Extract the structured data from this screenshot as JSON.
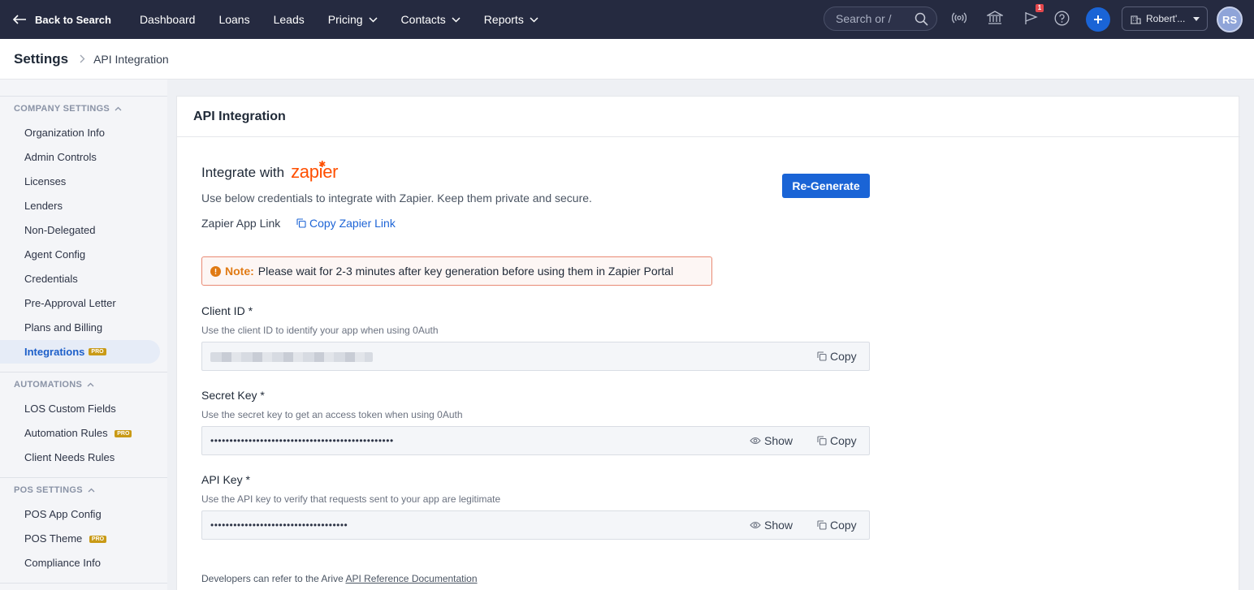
{
  "nav": {
    "back_label": "Back to Search",
    "items": [
      "Dashboard",
      "Loans",
      "Leads",
      "Pricing",
      "Contacts",
      "Reports"
    ],
    "search_placeholder": "Search or /",
    "notification_count": "1",
    "org_name": "Robert'...",
    "avatar_initials": "RS"
  },
  "breadcrumb": {
    "main": "Settings",
    "current": "API Integration"
  },
  "sidebar": {
    "company_header": "COMPANY SETTINGS",
    "company_items": [
      "Organization Info",
      "Admin Controls",
      "Licenses",
      "Lenders",
      "Non-Delegated",
      "Agent Config",
      "Credentials",
      "Pre-Approval Letter",
      "Plans and Billing"
    ],
    "active_item": "Integrations",
    "pro_badge": "PRO",
    "automations_header": "AUTOMATIONS",
    "automation_items": [
      "LOS Custom Fields",
      "Automation Rules",
      "Client Needs Rules"
    ],
    "pos_header": "POS SETTINGS",
    "pos_items": [
      "POS App Config",
      "POS Theme",
      "Compliance Info"
    ]
  },
  "main": {
    "title": "API Integration",
    "integrate_with": "Integrate with",
    "zapier_logo": "zapier",
    "description": "Use below credentials to integrate with Zapier. Keep them private and secure.",
    "app_link_label": "Zapier App Link",
    "copy_link_label": "Copy Zapier Link",
    "regenerate_label": "Re-Generate",
    "note_label": "Note:",
    "note_text": "Please wait for 2-3 minutes after key generation before using them in Zapier Portal",
    "client_id": {
      "label": "Client ID *",
      "help": "Use the client ID to identify your app when using 0Auth",
      "copy": "Copy"
    },
    "secret_key": {
      "label": "Secret Key *",
      "help": "Use the secret key to get an access token when using 0Auth",
      "masked": "••••••••••••••••••••••••••••••••••••••••••••••••",
      "show": "Show",
      "copy": "Copy"
    },
    "api_key": {
      "label": "API Key *",
      "help": "Use the API key to verify that requests sent to your app are legitimate",
      "masked": "••••••••••••••••••••••••••••••••••••",
      "show": "Show",
      "copy": "Copy"
    },
    "dev_note_prefix": "Developers can refer to the Arive",
    "dev_note_link": "API Reference Documentation"
  },
  "colors": {
    "nav_bg": "#252a40",
    "primary": "#1a64d6",
    "zapier": "#ff4f00",
    "note_border": "#e98a74",
    "note_label": "#e07a14",
    "pro_badge": "#c99a16"
  }
}
